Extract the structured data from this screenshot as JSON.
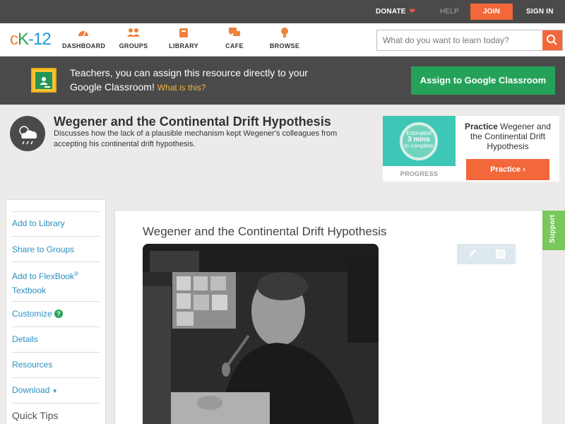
{
  "topbar": {
    "donate": "DONATE",
    "help": "HELP",
    "join": "JOIN",
    "signin": "SIGN IN"
  },
  "header": {
    "logo": {
      "c": "c",
      "k": "K",
      "twelve": "-12"
    },
    "nav": [
      {
        "label": "DASHBOARD",
        "icon": "dashboard-icon"
      },
      {
        "label": "GROUPS",
        "icon": "groups-icon"
      },
      {
        "label": "LIBRARY",
        "icon": "library-icon"
      },
      {
        "label": "CAFE",
        "icon": "cafe-icon"
      },
      {
        "label": "BROWSE",
        "icon": "browse-icon"
      }
    ],
    "search_placeholder": "What do you want to learn today?"
  },
  "banner": {
    "text": "Teachers, you can assign this resource directly to your Google Classroom!",
    "link": "What is this?",
    "assign_button": "Assign to Google Classroom"
  },
  "title": {
    "heading": "Wegener and the Continental Drift Hypothesis",
    "description": "Discusses how the lack of a plausible mechanism kept Wegener's colleagues from accepting his continental drift hypothesis."
  },
  "practice": {
    "estimated": "Estimated",
    "mins": "3 mins",
    "to_complete": "to complete",
    "progress_label": "PROGRESS",
    "title_bold": "Practice",
    "title_rest": "Wegener and the Continental Drift Hypothesis",
    "button": "Practice"
  },
  "sidebar": {
    "add_library": "Add to Library",
    "share_groups": "Share to Groups",
    "add_flexbook_1": "Add to FlexBook",
    "add_flexbook_reg": "®",
    "add_flexbook_2": "Textbook",
    "customize": "Customize",
    "help_mark": "?",
    "details": "Details",
    "resources": "Resources",
    "download": "Download",
    "download_arrow": "▼",
    "quick_tips": "Quick Tips"
  },
  "content": {
    "title": "Wegener and the Continental Drift Hypothesis"
  },
  "support_tab": "Support",
  "colors": {
    "accent_orange": "#f3683b",
    "google_green": "#25a25a",
    "link_blue": "#2c8fc2",
    "dark_bar": "#4a4a4a"
  }
}
